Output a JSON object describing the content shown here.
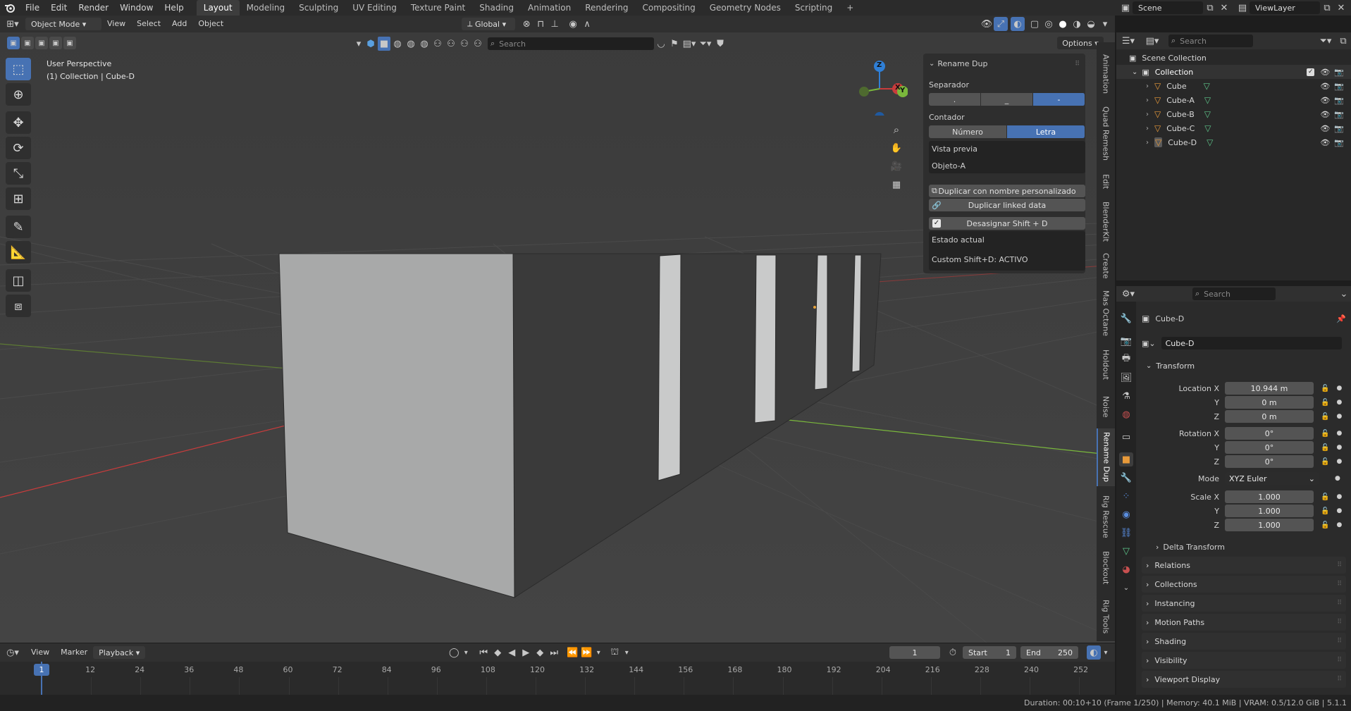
{
  "topbar": {
    "menus": [
      "File",
      "Edit",
      "Render",
      "Window",
      "Help"
    ],
    "workspaces": [
      "Layout",
      "Modeling",
      "Sculpting",
      "UV Editing",
      "Texture Paint",
      "Shading",
      "Animation",
      "Rendering",
      "Compositing",
      "Geometry Nodes",
      "Scripting"
    ],
    "active_workspace": "Layout",
    "add_tab": "+",
    "scene": "Scene",
    "view_layer": "ViewLayer"
  },
  "viewport_header": {
    "mode": "Object Mode",
    "menus": [
      "View",
      "Select",
      "Add",
      "Object"
    ],
    "transform_orientation": "Global",
    "search_placeholder": "Search",
    "options": "Options"
  },
  "viewport": {
    "perspective": "User Perspective",
    "collection_info": "(1) Collection | Cube-D",
    "gizmo": {
      "z": "Z",
      "y": "Y",
      "x": "X"
    }
  },
  "rename_panel": {
    "title": "Rename Dup",
    "separador_label": "Separador",
    "separador_options": [
      ".",
      "_",
      "-"
    ],
    "separador_active": "-",
    "contador_label": "Contador",
    "contador_options": [
      "Número",
      "Letra"
    ],
    "contador_active": "Letra",
    "vista_previa": "Vista previa",
    "preview_value": "Objeto-A",
    "dup_custom": "Duplicar con nombre personalizado",
    "dup_linked": "Duplicar linked data",
    "desasignar": "Desasignar Shift + D",
    "estado_actual": "Estado actual",
    "custom_status": "Custom Shift+D: ACTIVO"
  },
  "side_tabs": [
    "Animation",
    "Quad Remesh",
    "Edit",
    "BlenderKit",
    "Create",
    "Mas Octane",
    "Holdout",
    "Noise",
    "Rename Dup",
    "Rig Rescue",
    "Blockout",
    "Rig Tools"
  ],
  "active_side_tab": "Rename Dup",
  "outliner": {
    "search_placeholder": "Search",
    "root": "Scene Collection",
    "collection": "Collection",
    "objects": [
      "Cube",
      "Cube-A",
      "Cube-B",
      "Cube-C",
      "Cube-D"
    ]
  },
  "properties": {
    "search_placeholder": "Search",
    "object_name": "Cube-D",
    "datablock_name": "Cube-D",
    "transform_title": "Transform",
    "location_label": "Location X",
    "location": [
      "10.944 m",
      "0 m",
      "0 m"
    ],
    "rotation_label": "Rotation X",
    "rotation": [
      "0°",
      "0°",
      "0°"
    ],
    "mode_label": "Mode",
    "mode_value": "XYZ Euler",
    "scale_label": "Scale X",
    "scale": [
      "1.000",
      "1.000",
      "1.000"
    ],
    "axis_y": "Y",
    "axis_z": "Z",
    "delta_transform": "Delta Transform",
    "sections": [
      "Relations",
      "Collections",
      "Instancing",
      "Motion Paths",
      "Shading",
      "Visibility",
      "Viewport Display"
    ]
  },
  "timeline": {
    "menus": [
      "View",
      "Marker",
      "Playback"
    ],
    "current_frame": "1",
    "start_label": "Start",
    "start": "1",
    "end_label": "End",
    "end": "250",
    "ticks": [
      "1",
      "12",
      "24",
      "36",
      "48",
      "60",
      "72",
      "84",
      "96",
      "108",
      "120",
      "132",
      "144",
      "156",
      "168",
      "180",
      "192",
      "204",
      "216",
      "228",
      "240",
      "252"
    ]
  },
  "status_bar": {
    "text": "Duration: 00:10+10 (Frame 1/250) | Memory: 40.1 MiB | VRAM: 0.5/12.0 GiB | 5.1.1"
  },
  "colors": {
    "accent": "#4772b3",
    "viewport_bg": "#3f3f3f",
    "panel_bg": "#2e2e2e",
    "mesh_face": "#a8a9a9",
    "axis_x": "#c83c3c",
    "axis_y": "#7ab83c",
    "gizmo_z": "#2f7fd6"
  }
}
